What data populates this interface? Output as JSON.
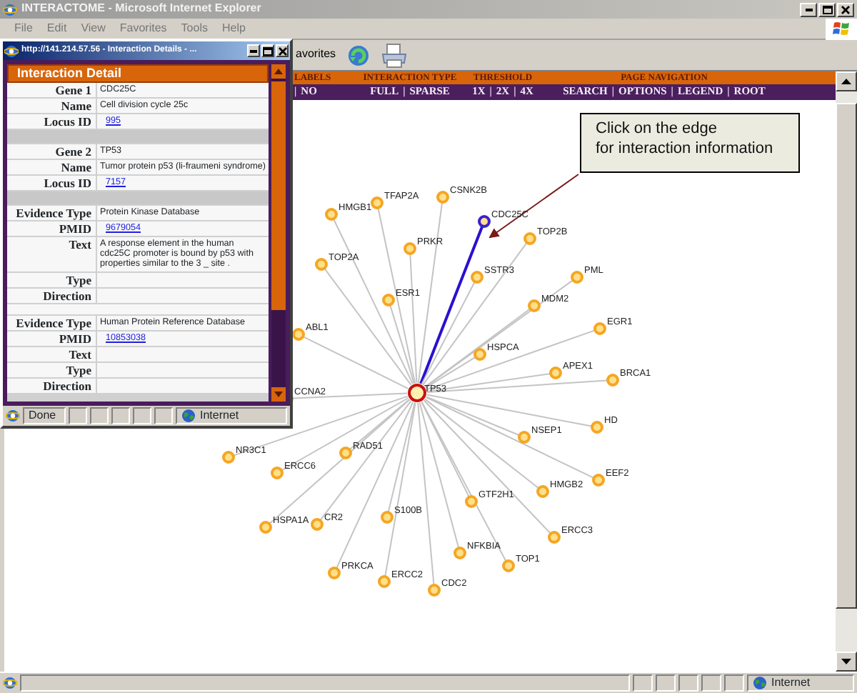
{
  "main_window": {
    "title": "INTERACTOME - Microsoft Internet Explorer",
    "menu": [
      "File",
      "Edit",
      "View",
      "Favorites",
      "Tools",
      "Help"
    ],
    "toolbar": {
      "favorites_label": "avorites"
    },
    "nav_bar": {
      "headers": [
        "LABELS",
        "INTERACTION TYPE",
        "THRESHOLD",
        "PAGE NAVIGATION"
      ],
      "groups": [
        [
          {
            "kind": "sep",
            "text": "|"
          },
          {
            "kind": "link",
            "text": "NO"
          }
        ],
        [
          {
            "kind": "link",
            "text": "FULL"
          },
          {
            "kind": "sep",
            "text": "|"
          },
          {
            "kind": "link",
            "text": "SPARSE"
          }
        ],
        [
          {
            "kind": "link",
            "text": "1X"
          },
          {
            "kind": "sep",
            "text": "|"
          },
          {
            "kind": "link",
            "text": "2X"
          },
          {
            "kind": "sep",
            "text": "|"
          },
          {
            "kind": "link",
            "text": "4X"
          }
        ],
        [
          {
            "kind": "link",
            "text": "SEARCH"
          },
          {
            "kind": "sep",
            "text": "|"
          },
          {
            "kind": "link",
            "text": "OPTIONS"
          },
          {
            "kind": "sep",
            "text": "|"
          },
          {
            "kind": "link",
            "text": "LEGEND"
          },
          {
            "kind": "sep",
            "text": "|"
          },
          {
            "kind": "link",
            "text": "ROOT"
          }
        ]
      ]
    },
    "callout": {
      "lines": [
        "Click on the edge",
        "for interaction information"
      ]
    },
    "graph": {
      "center": {
        "label": "TP53"
      },
      "nodes": [
        {
          "label": "HMGB1",
          "selected": false
        },
        {
          "label": "TFAP2A",
          "selected": false
        },
        {
          "label": "CSNK2B",
          "selected": false
        },
        {
          "label": "CDC25C",
          "selected": true
        },
        {
          "label": "TOP2B",
          "selected": false
        },
        {
          "label": "PRKR",
          "selected": false
        },
        {
          "label": "TOP2A",
          "selected": false
        },
        {
          "label": "SSTR3",
          "selected": false
        },
        {
          "label": "PML",
          "selected": false
        },
        {
          "label": "ESR1",
          "selected": false
        },
        {
          "label": "MDM2",
          "selected": false
        },
        {
          "label": "EGR1",
          "selected": false
        },
        {
          "label": "ABL1",
          "selected": false
        },
        {
          "label": "HSPCA",
          "selected": false
        },
        {
          "label": "APEX1",
          "selected": false
        },
        {
          "label": "BRCA1",
          "selected": false
        },
        {
          "label": "CCNA2",
          "selected": false
        },
        {
          "label": "HD",
          "selected": false
        },
        {
          "label": "NSEP1",
          "selected": false
        },
        {
          "label": "NR3C1",
          "selected": false
        },
        {
          "label": "RAD51",
          "selected": false
        },
        {
          "label": "ERCC6",
          "selected": false
        },
        {
          "label": "EEF2",
          "selected": false
        },
        {
          "label": "HMGB2",
          "selected": false
        },
        {
          "label": "GTF2H1",
          "selected": false
        },
        {
          "label": "S100B",
          "selected": false
        },
        {
          "label": "HSPA1A",
          "selected": false
        },
        {
          "label": "CR2",
          "selected": false
        },
        {
          "label": "ERCC3",
          "selected": false
        },
        {
          "label": "NFKBIA",
          "selected": false
        },
        {
          "label": "TOP1",
          "selected": false
        },
        {
          "label": "PRKCA",
          "selected": false
        },
        {
          "label": "ERCC2",
          "selected": false
        },
        {
          "label": "CDC2",
          "selected": false
        }
      ]
    },
    "status_bar": {
      "zone": "Internet"
    }
  },
  "popup": {
    "title": "http://141.214.57.56 - Interaction Details - ...",
    "header": "Interaction Detail",
    "rows": [
      {
        "kind": "field",
        "label": "Gene 1",
        "value": "CDC25C"
      },
      {
        "kind": "field",
        "label": "Name",
        "value": "Cell division cycle 25c"
      },
      {
        "kind": "link",
        "label": "Locus ID",
        "value": "995"
      },
      {
        "kind": "spacer"
      },
      {
        "kind": "field",
        "label": "Gene 2",
        "value": "TP53"
      },
      {
        "kind": "field",
        "label": "Name",
        "value": "Tumor protein p53 (li-fraumeni syndrome)"
      },
      {
        "kind": "link",
        "label": "Locus ID",
        "value": "7157"
      },
      {
        "kind": "spacer"
      },
      {
        "kind": "field",
        "label": "Evidence Type",
        "value": "Protein Kinase Database"
      },
      {
        "kind": "link",
        "label": "PMID",
        "value": "9679054"
      },
      {
        "kind": "field",
        "label": "Text",
        "value": "A response element in the human cdc25C promoter is bound by p53 with properties similar to the 3 _ site ."
      },
      {
        "kind": "field",
        "label": "Type"
      },
      {
        "kind": "field",
        "label": "Direction"
      },
      {
        "kind": "blank"
      },
      {
        "kind": "field",
        "label": "Evidence Type",
        "value": "Human Protein Reference Database"
      },
      {
        "kind": "link",
        "label": "PMID",
        "value": "10853038"
      },
      {
        "kind": "field",
        "label": "Text"
      },
      {
        "kind": "field",
        "label": "Type"
      },
      {
        "kind": "field",
        "label": "Direction"
      }
    ],
    "status_bar": {
      "text": "Done",
      "zone": "Internet"
    }
  }
}
